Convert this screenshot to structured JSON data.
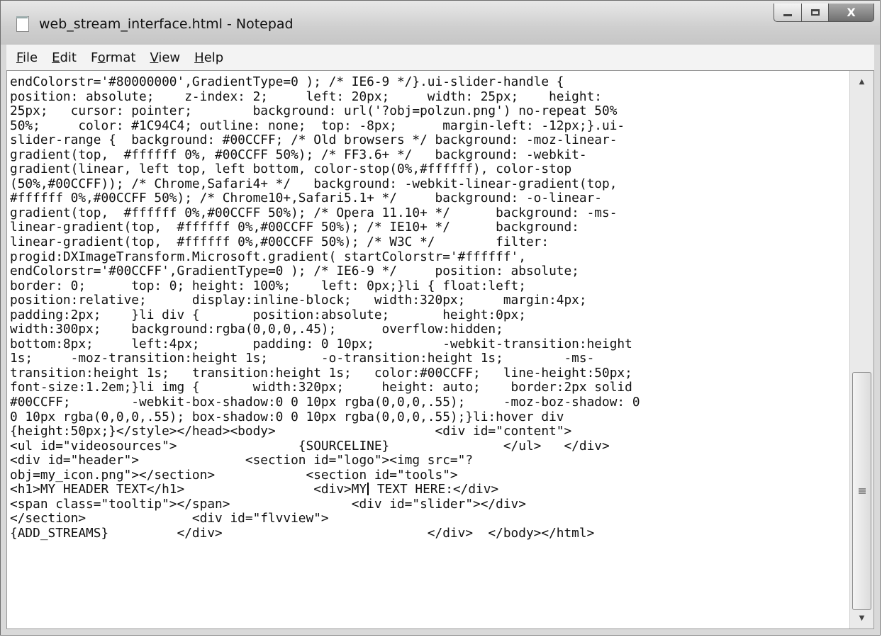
{
  "window": {
    "title": "web_stream_interface.html - Notepad",
    "controls": {
      "minimize_icon": "minimize-icon",
      "maximize_icon": "maximize-icon",
      "close_glyph": "X"
    }
  },
  "menu": [
    {
      "accel": "F",
      "rest": "ile"
    },
    {
      "accel": "E",
      "rest": "dit"
    },
    {
      "pre": "F",
      "accel": "o",
      "rest": "rmat"
    },
    {
      "accel": "V",
      "rest": "iew"
    },
    {
      "accel": "H",
      "rest": "elp"
    }
  ],
  "editor": {
    "lines": [
      "endColorstr='#80000000',GradientType=0 ); /* IE6-9 */}.ui-slider-handle {",
      "position: absolute;    z-index: 2;     left: 20px;     width: 25px;    height:",
      "25px;   cursor: pointer;        background: url('?obj=polzun.png') no-repeat 50%",
      "50%;     color: #1C94C4; outline: none;  top: -8px;      margin-left: -12px;}.ui-",
      "slider-range {  background: #00CCFF; /* Old browsers */ background: -moz-linear-",
      "gradient(top,  #ffffff 0%, #00CCFF 50%); /* FF3.6+ */   background: -webkit-",
      "gradient(linear, left top, left bottom, color-stop(0%,#ffffff), color-stop",
      "(50%,#00CCFF)); /* Chrome,Safari4+ */   background: -webkit-linear-gradient(top,",
      "#ffffff 0%,#00CCFF 50%); /* Chrome10+,Safari5.1+ */     background: -o-linear-",
      "gradient(top,  #ffffff 0%,#00CCFF 50%); /* Opera 11.10+ */      background: -ms-",
      "linear-gradient(top,  #ffffff 0%,#00CCFF 50%); /* IE10+ */      background:",
      "linear-gradient(top,  #ffffff 0%,#00CCFF 50%); /* W3C */        filter:",
      "progid:DXImageTransform.Microsoft.gradient( startColorstr='#ffffff',",
      "endColorstr='#00CCFF',GradientType=0 ); /* IE6-9 */     position: absolute;",
      "border: 0;      top: 0; height: 100%;    left: 0px;}li { float:left;",
      "position:relative;      display:inline-block;   width:320px;     margin:4px;",
      "padding:2px;    }li div {       position:absolute;       height:0px;",
      "width:300px;    background:rgba(0,0,0,.45);      overflow:hidden;",
      "bottom:8px;     left:4px;       padding: 0 10px;         -webkit-transition:height",
      "1s;     -moz-transition:height 1s;       -o-transition:height 1s;        -ms-",
      "transition:height 1s;   transition:height 1s;   color:#00CCFF;   line-height:50px;",
      "font-size:1.2em;}li img {       width:320px;     height: auto;    border:2px solid",
      "#00CCFF;        -webkit-box-shadow:0 0 10px rgba(0,0,0,.55);     -moz-boz-shadow: 0",
      "0 10px rgba(0,0,0,.55); box-shadow:0 0 10px rgba(0,0,0,.55);}li:hover div",
      "{height:50px;}</style></head><body>                     <div id=\"content\">",
      "<ul id=\"videosources\">                {SOURCELINE}               </ul>   </div>",
      "<div id=\"header\">              <section id=\"logo\"><img src=\"?",
      "obj=my_icon.png\"></section>            <section id=\"tools\">",
      "<h1>MY HEADER TEXT</h1>                 <div>MY TEXT HERE:</div>",
      "<span class=\"tooltip\"></span>                <div id=\"slider\"></div>",
      "</section>              <div id=\"flvview\">",
      "{ADD_STREAMS}         </div>                           </div>  </body></html>"
    ],
    "caret_line": 28,
    "caret_after": "<h1>MY HEADER TEXT</h1>                 <div>MY",
    "caret_before": " TEXT HERE:</div>"
  },
  "scrollbar": {
    "up_icon": "scroll-up-arrow-icon",
    "down_icon": "scroll-down-arrow-icon",
    "position_fraction": 0.72
  }
}
